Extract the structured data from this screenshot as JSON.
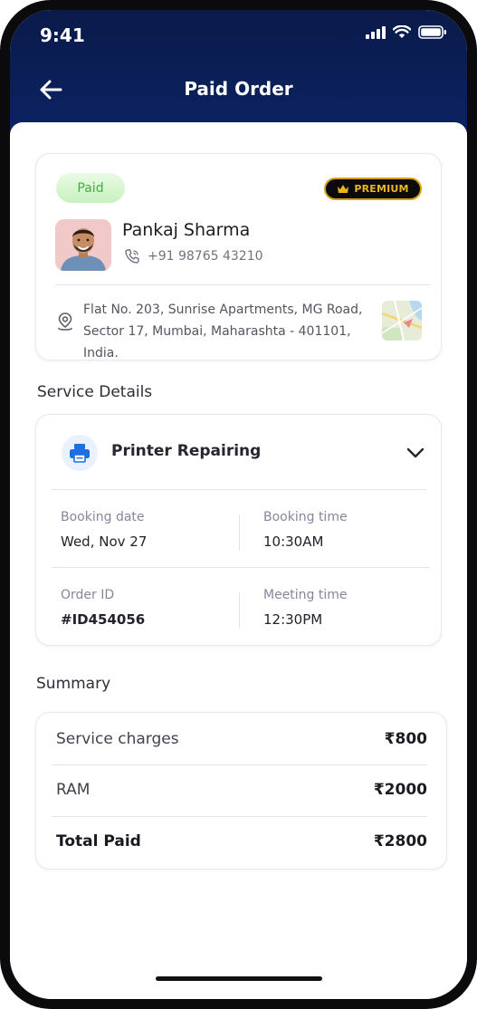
{
  "status_bar": {
    "time": "9:41"
  },
  "header": {
    "title": "Paid Order",
    "back_icon": "arrow-left-icon"
  },
  "customer": {
    "status_badge": "Paid",
    "premium_badge": "PREMIUM",
    "name": "Pankaj Sharma",
    "phone": "+91 98765 43210",
    "address_line1": "Flat No. 203, Sunrise Apartments, MG Road,",
    "address_line2": "Sector 17, Mumbai, Maharashta - 401101, India."
  },
  "service_details": {
    "section_title": "Service Details",
    "service_name": "Printer Repairing",
    "booking_date_label": "Booking date",
    "booking_date": "Wed, Nov 27",
    "booking_time_label": "Booking time",
    "booking_time": "10:30AM",
    "order_id_label": "Order ID",
    "order_id": "#ID454056",
    "meeting_time_label": "Meeting time",
    "meeting_time": "12:30PM"
  },
  "summary": {
    "section_title": "Summary",
    "rows": [
      {
        "label": "Service charges",
        "value": "₹800"
      },
      {
        "label": "RAM",
        "value": "₹2000"
      }
    ],
    "total_label": "Total Paid",
    "total_value": "₹2800"
  },
  "colors": {
    "header_bg": "#0c2466",
    "paid_green": "#3fae45",
    "premium_gold": "#e8b61c",
    "service_icon_blue": "#1f6fe0"
  }
}
